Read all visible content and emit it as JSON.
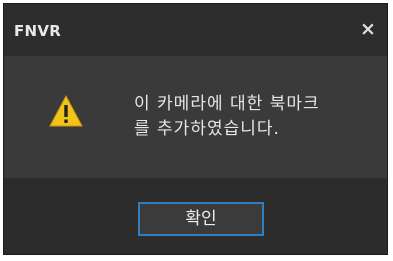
{
  "window": {
    "title": "FNVR",
    "close_symbol": "×",
    "close_icon": "close-icon"
  },
  "content": {
    "icon": "warning-icon",
    "message": "이 카메라에 대한 북마크\n를 추가하였습니다."
  },
  "footer": {
    "ok_label": "확인"
  },
  "colors": {
    "background": "#3a3a3a",
    "titlebar": "#2d2d2d",
    "footer": "#2c2c2c",
    "button_border": "#2f7fc0",
    "warning_yellow": "#f2c318"
  }
}
